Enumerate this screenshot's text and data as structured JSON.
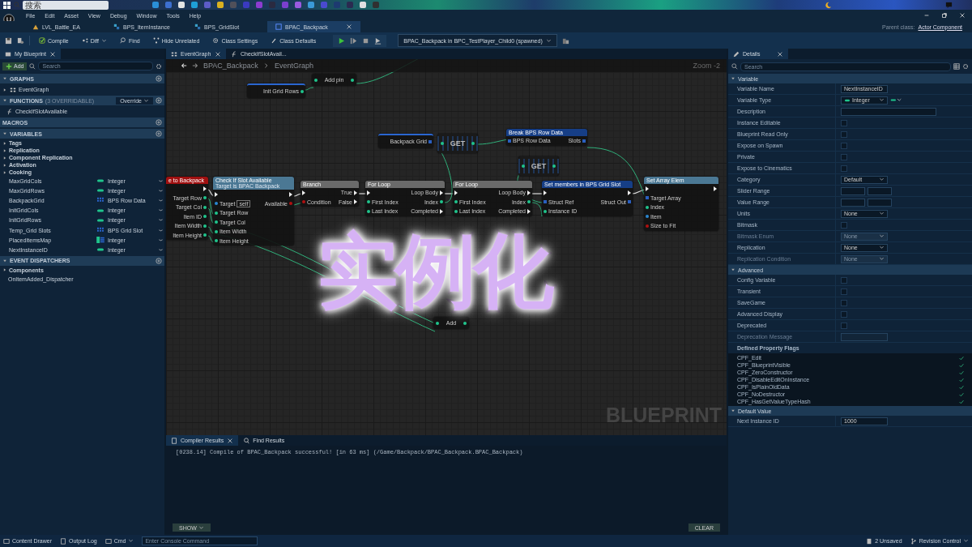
{
  "taskbar": {
    "search_placeholder": "搜索"
  },
  "menu": [
    "File",
    "Edit",
    "Asset",
    "View",
    "Debug",
    "Window",
    "Tools",
    "Help"
  ],
  "doc_tabs": [
    {
      "label": "LVL_Battle_EA",
      "kind": "level",
      "selected": false
    },
    {
      "label": "BPS_ItemInstance",
      "kind": "struct",
      "selected": false
    },
    {
      "label": "BPS_GridSlot",
      "kind": "struct",
      "selected": false
    },
    {
      "label": "BPAC_Backpack",
      "kind": "blueprint",
      "selected": true
    }
  ],
  "parent_class": {
    "label": "Parent class:",
    "value": "Actor Component"
  },
  "toolbar": {
    "buttons": [
      {
        "label": "Compile",
        "kind": "compile"
      },
      {
        "label": "Diff",
        "kind": "diff"
      },
      {
        "label": "Find",
        "kind": "find"
      },
      {
        "label": "Hide Unrelated",
        "kind": "hide"
      },
      {
        "label": "Class Settings",
        "kind": "settings"
      },
      {
        "label": "Class Defaults",
        "kind": "defaults"
      }
    ],
    "debug_object": "BPAC_Backpack in BPC_TestPlayer_Child0 (spawned)"
  },
  "my_blueprint": {
    "tab": "My Blueprint",
    "add_button": "Add",
    "search_placeholder": "Search",
    "sections": [
      {
        "title": "GRAPHS",
        "items": [
          {
            "label": "EventGraph",
            "kind": "graph"
          }
        ]
      },
      {
        "title": "FUNCTIONS",
        "note": "(3 OVERRIDABLE)",
        "dropdown": "Override",
        "items": [
          {
            "label": "CheckIfSlotAvailable",
            "kind": "function"
          }
        ]
      },
      {
        "title": "MACROS"
      },
      {
        "title": "VARIABLES",
        "categories": [
          "Tags",
          "Replication",
          "Component Replication",
          "Activation",
          "Cooking"
        ],
        "variables": [
          {
            "name": "MaxGridCols",
            "type": "Integer",
            "kind": "single",
            "color": "#1fc48c"
          },
          {
            "name": "MaxGridRows",
            "type": "Integer",
            "kind": "single",
            "color": "#1fc48c"
          },
          {
            "name": "BackpackGrid",
            "type": "BPS Row Data",
            "kind": "array",
            "color": "#2a66d0"
          },
          {
            "name": "InitGridCols",
            "type": "Integer",
            "kind": "single",
            "color": "#1fc48c"
          },
          {
            "name": "InitGridRows",
            "type": "Integer",
            "kind": "single",
            "color": "#1fc48c"
          },
          {
            "name": "Temp_Grid Slots",
            "type": "BPS Grid Slot",
            "kind": "array",
            "color": "#2a66d0"
          },
          {
            "name": "PlacedItemsMap",
            "type": "Integer",
            "kind": "map",
            "color": "#1fc48c"
          },
          {
            "name": "NextInstanceID",
            "type": "Integer",
            "kind": "single",
            "color": "#1fc48c"
          }
        ]
      },
      {
        "title": "EVENT DISPATCHERS",
        "categories": [
          "Components"
        ],
        "items": [
          {
            "label": "OnItemAdded_Dispatcher",
            "kind": "dispatcher"
          }
        ]
      }
    ]
  },
  "graph": {
    "tabs": [
      {
        "label": "EventGraph",
        "kind": "graph",
        "selected": true
      },
      {
        "label": "CheckIfSlotAvail...",
        "kind": "function",
        "selected": false
      }
    ],
    "breadcrumb": [
      "BPAC_Backpack",
      "EventGraph"
    ],
    "zoom": "Zoom -2",
    "watermark": "BLUEPRINT",
    "nodes": [
      {
        "kind": "variable",
        "outputs": [
          {
            "label": "Init Grid Rows",
            "kind": "int"
          }
        ]
      },
      {
        "kind": "compact",
        "text": "Add pin"
      },
      {
        "kind": "variable",
        "outputs": [
          {
            "label": "Backpack Grid",
            "kind": "struct"
          }
        ]
      },
      {
        "kind": "get",
        "text": "GET"
      },
      {
        "kind": "struct",
        "title": "Break BPS Row Data",
        "inputs": [
          {
            "label": "BPS Row Data",
            "kind": "struct"
          }
        ],
        "outputs": [
          {
            "label": "Slots",
            "kind": "struct"
          }
        ]
      },
      {
        "kind": "get",
        "text": "GET"
      },
      {
        "kind": "event",
        "title": "e to Backpack",
        "outputs": [
          {
            "kind": "exec"
          },
          {
            "label": "Target Row",
            "kind": "int"
          },
          {
            "label": "Target Col",
            "kind": "int"
          },
          {
            "label": "Item ID",
            "kind": "int"
          },
          {
            "label": "Item Width",
            "kind": "int"
          },
          {
            "label": "Item Height",
            "kind": "int"
          }
        ]
      },
      {
        "kind": "function",
        "title": "Check If Slot Available",
        "subtitle": "Target is BPAC Backpack",
        "inputs": [
          {
            "kind": "exec"
          },
          {
            "label": "Target",
            "kind": "object",
            "value": "self"
          },
          {
            "label": "Target Row",
            "kind": "int"
          },
          {
            "label": "Target Col",
            "kind": "int"
          },
          {
            "label": "Item Width",
            "kind": "int"
          },
          {
            "label": "Item Height",
            "kind": "int"
          }
        ],
        "outputs": [
          {
            "kind": "exec"
          },
          {
            "label": "Available",
            "kind": "bool"
          }
        ]
      },
      {
        "kind": "macro",
        "title": "Branch",
        "inputs": [
          {
            "kind": "exec"
          },
          {
            "label": "Condition",
            "kind": "bool"
          }
        ],
        "outputs": [
          {
            "label": "True",
            "kind": "exec"
          },
          {
            "label": "False",
            "kind": "exec"
          }
        ]
      },
      {
        "kind": "macro",
        "title": "For Loop",
        "inputs": [
          {
            "kind": "exec"
          },
          {
            "label": "First Index",
            "kind": "int"
          },
          {
            "label": "Last Index",
            "kind": "int"
          }
        ],
        "outputs": [
          {
            "label": "Loop Body",
            "kind": "exec"
          },
          {
            "label": "Index",
            "kind": "int"
          },
          {
            "label": "Completed",
            "kind": "exec"
          }
        ]
      },
      {
        "kind": "macro",
        "title": "For Loop",
        "inputs": [
          {
            "kind": "exec"
          },
          {
            "label": "First Index",
            "kind": "int"
          },
          {
            "label": "Last Index",
            "kind": "int"
          }
        ],
        "outputs": [
          {
            "label": "Loop Body",
            "kind": "exec"
          },
          {
            "label": "Index",
            "kind": "int"
          },
          {
            "label": "Completed",
            "kind": "exec"
          }
        ]
      },
      {
        "kind": "struct",
        "title": "Set members in BPS Grid Slot",
        "inputs": [
          {
            "kind": "exec"
          },
          {
            "label": "Struct Ref",
            "kind": "struct"
          },
          {
            "label": "Instance ID",
            "kind": "int"
          }
        ],
        "outputs": [
          {
            "kind": "exec"
          },
          {
            "label": "Struct Out",
            "kind": "struct"
          }
        ]
      },
      {
        "kind": "function",
        "title": "Set Array Elem",
        "inputs": [
          {
            "kind": "exec"
          },
          {
            "label": "Target Array",
            "kind": "struct"
          },
          {
            "label": "Index",
            "kind": "int"
          },
          {
            "label": "Item",
            "kind": "object"
          },
          {
            "label": "Size to Fit",
            "kind": "bool"
          }
        ],
        "outputs": [
          {
            "kind": "exec"
          }
        ]
      },
      {
        "kind": "compact",
        "text": "Add"
      }
    ]
  },
  "caption": "实例化",
  "compiler": {
    "tabs": [
      {
        "label": "Compiler Results",
        "selected": true
      },
      {
        "label": "Find Results",
        "selected": false
      }
    ],
    "messages": [
      "[0238.14] Compile of BPAC_Backpack successful! [in 63 ms] (/Game/Backpack/BPAC_Backpack.BPAC_Backpack)"
    ],
    "show_button": "SHOW",
    "clear_button": "CLEAR"
  },
  "details": {
    "tab": "Details",
    "search_placeholder": "Search",
    "sections": [
      {
        "title": "Variable",
        "rows": [
          {
            "label": "Variable Name",
            "kind": "text",
            "value": "NextInstanceID"
          },
          {
            "label": "Variable Type",
            "kind": "type",
            "value": "Integer"
          },
          {
            "label": "Description",
            "kind": "text"
          },
          {
            "label": "Instance Editable",
            "kind": "checkbox",
            "checked": false
          },
          {
            "label": "Blueprint Read Only",
            "kind": "checkbox",
            "checked": false
          },
          {
            "label": "Expose on Spawn",
            "kind": "checkbox",
            "checked": false
          },
          {
            "label": "Private",
            "kind": "checkbox",
            "checked": false
          },
          {
            "label": "Expose to Cinematics",
            "kind": "checkbox",
            "checked": false
          },
          {
            "label": "Category",
            "kind": "dropdown",
            "value": "Default",
            "disabled": false
          },
          {
            "label": "Slider Range",
            "kind": "range"
          },
          {
            "label": "Value Range",
            "kind": "range"
          },
          {
            "label": "Units",
            "kind": "dropdown",
            "value": "None",
            "disabled": false
          },
          {
            "label": "Bitmask",
            "kind": "checkbox",
            "checked": false
          },
          {
            "label": "Bitmask Enum",
            "kind": "dropdown",
            "value": "None",
            "disabled": true
          },
          {
            "label": "Replication",
            "kind": "dropdown",
            "value": "None",
            "disabled": false
          },
          {
            "label": "Replication Condition",
            "kind": "dropdown",
            "value": "None",
            "disabled": true
          }
        ]
      },
      {
        "title": "Advanced",
        "rows": [
          {
            "label": "Config Variable",
            "kind": "checkbox",
            "checked": false
          },
          {
            "label": "Transient",
            "kind": "checkbox",
            "checked": false
          },
          {
            "label": "SaveGame",
            "kind": "checkbox",
            "checked": false
          },
          {
            "label": "Advanced Display",
            "kind": "checkbox",
            "checked": false
          },
          {
            "label": "Deprecated",
            "kind": "checkbox",
            "checked": false
          },
          {
            "label": "Deprecation Message",
            "kind": "text",
            "disabled": true
          },
          {
            "label": "Defined Property Flags",
            "kind": "flags",
            "flags": [
              {
                "label": "CPF_Edit",
                "checked": true
              },
              {
                "label": "CPF_BlueprintVisible",
                "checked": true
              },
              {
                "label": "CPF_ZeroConstructor",
                "checked": true
              },
              {
                "label": "CPF_DisableEditOnInstance",
                "checked": true
              },
              {
                "label": "CPF_IsPlainOldData",
                "checked": true
              },
              {
                "label": "CPF_NoDestructor",
                "checked": true
              },
              {
                "label": "CPF_HasGetValueTypeHash",
                "checked": true
              }
            ]
          }
        ]
      },
      {
        "title": "Default Value",
        "rows": [
          {
            "label": "Next Instance ID",
            "kind": "text",
            "value": "1000"
          }
        ]
      }
    ]
  },
  "status_bar": {
    "content_drawer": "Content Drawer",
    "output_log": "Output Log",
    "cmd": "Cmd",
    "console_placeholder": "Enter Console Command",
    "unsaved": "2 Unsaved",
    "revision_control": "Revision Control"
  }
}
